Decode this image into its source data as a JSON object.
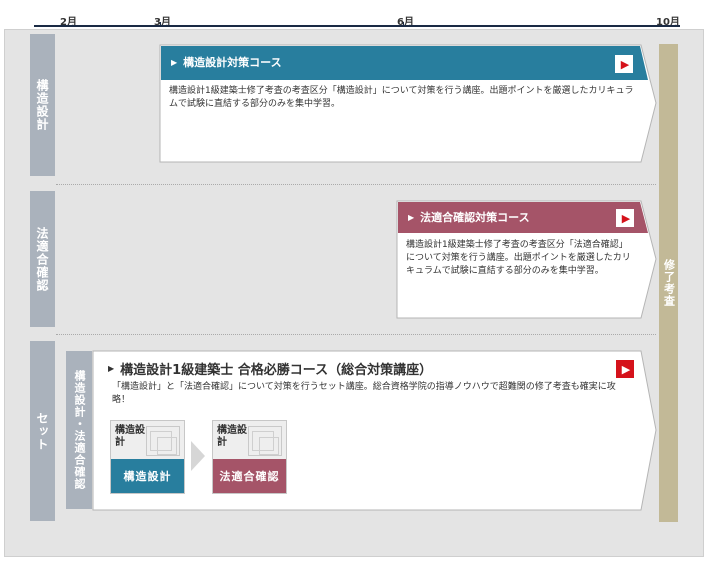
{
  "timeline": {
    "months": [
      "2月",
      "3月",
      "6月",
      "10月"
    ]
  },
  "rows": [
    {
      "label": "構造設計"
    },
    {
      "label": "法適合確認"
    },
    {
      "label": "セット"
    }
  ],
  "goal_label": "修了考査",
  "courses": [
    {
      "title": "構造設計対策コース",
      "description": "構造設計1級建築士修了考査の考査区分「構造設計」について対策を行う講座。出題ポイントを厳選したカリキュラムで試験に直結する部分のみを集中学習。",
      "color": "#287e9e"
    },
    {
      "title": "法適合確認対策コース",
      "description": "構造設計1級建築士修了考査の考査区分「法適合確認」について対策を行う講座。出題ポイントを厳選したカリキュラムで試験に直結する部分のみを集中学習。",
      "color": "#a55468"
    },
    {
      "sublabel": "構造設計・法適合確認",
      "title": "構造設計1級建築士 合格必勝コース（総合対策講座）",
      "description": "「構造設計」と「法適合確認」について対策を行うセット講座。総合資格学院の指導ノウハウで超難関の修了考査も確実に攻略！",
      "components": [
        {
          "top": "構造設計",
          "label": "構造設計",
          "color": "#287e9e"
        },
        {
          "top": "構造設計",
          "label": "法適合確認",
          "color": "#a55468"
        }
      ]
    }
  ]
}
